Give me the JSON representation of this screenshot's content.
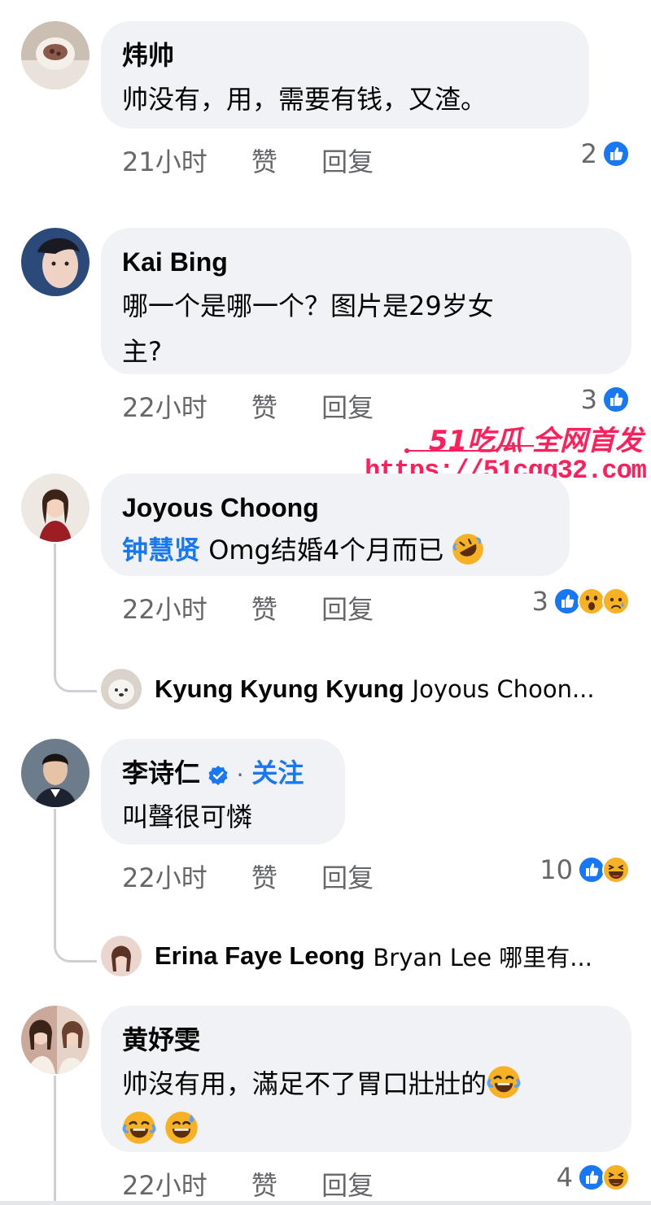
{
  "comments": [
    {
      "name": "炜帅",
      "text": "帅没有，用，需要有钱，又渣。",
      "time": "21小时",
      "like_label": "赞",
      "reply_label": "回复",
      "reaction_count": "2",
      "reactions": [
        "like-icon"
      ]
    },
    {
      "name": "Kai Bing",
      "text_line1": "哪一个是哪一个？图片是29岁女",
      "text_line2": "主?",
      "time": "22小时",
      "like_label": "赞",
      "reply_label": "回复",
      "reaction_count": "3",
      "reactions": [
        "like-icon"
      ]
    },
    {
      "name": "Joyous Choong",
      "mention": "钟慧贤",
      "text": " Omg结婚4个月而已",
      "time": "22小时",
      "like_label": "赞",
      "reply_label": "回复",
      "reaction_count": "3",
      "reactions": [
        "like-icon",
        "wow-icon",
        "sad-icon"
      ],
      "reply": {
        "name": "Kyung Kyung Kyung",
        "preview": "Joyous Choon..."
      }
    },
    {
      "name": "李诗仁",
      "verified": true,
      "separator": "·",
      "follow_label": "关注",
      "text": "叫聲很可憐",
      "time": "22小时",
      "like_label": "赞",
      "reply_label": "回复",
      "reaction_count": "10",
      "reactions": [
        "like-icon",
        "haha-icon"
      ],
      "reply": {
        "name": "Erina Faye Leong",
        "preview": "Bryan Lee 哪里有..."
      }
    },
    {
      "name": "黄妤雯",
      "text_line1": "帅沒有用，滿足不了胃口壯壯的",
      "time": "22小时",
      "like_label": "赞",
      "reply_label": "回复",
      "reaction_count": "4",
      "reactions": [
        "like-icon",
        "haha-icon"
      ]
    }
  ],
  "watermark": {
    "line1": "51吃瓜 全网首发",
    "url": "https://51cgg32.com"
  },
  "colors": {
    "like_blue": "#1877f2",
    "bubble_bg": "#f0f2f5",
    "meta_gray": "#65676b",
    "watermark_red": "#ff1f5a"
  }
}
